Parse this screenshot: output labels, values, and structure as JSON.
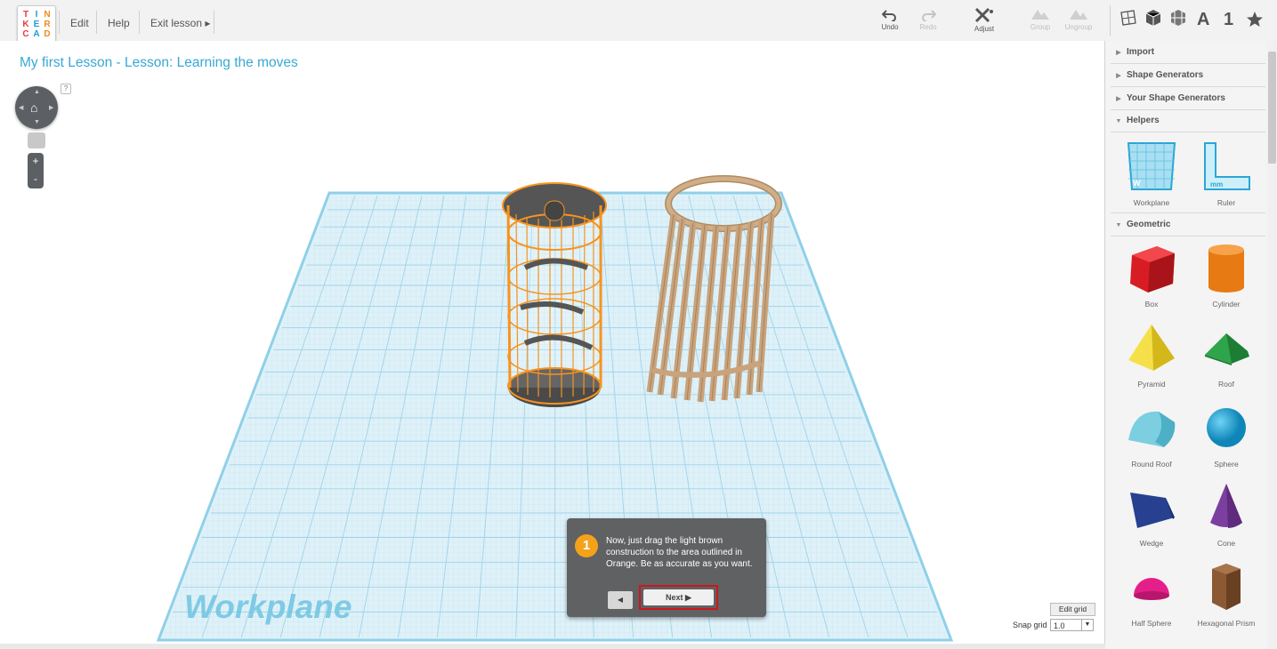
{
  "logo": {
    "letters": [
      "T",
      "I",
      "N",
      "K",
      "E",
      "R",
      "C",
      "A",
      "D"
    ]
  },
  "menu": {
    "edit": "Edit",
    "help": "Help",
    "exit_lesson": "Exit lesson ▸"
  },
  "toolbar": {
    "undo": "Undo",
    "redo": "Redo",
    "adjust": "Adjust",
    "group": "Group",
    "ungroup": "Ungroup"
  },
  "view_icons": {
    "text_icon": "A",
    "one_icon": "1"
  },
  "canvas": {
    "lesson_title": "My first Lesson - Lesson: Learning the moves",
    "help_mark": "?",
    "zoom_in": "+",
    "zoom_out": "-",
    "workplane_label": "Workplane",
    "edit_grid": "Edit grid",
    "snap_grid_label": "Snap grid",
    "snap_grid_value": "1.0"
  },
  "tip": {
    "step": "1",
    "text": "Now, just drag the light brown construction to the area outlined in Orange. Be as accurate as you want.",
    "prev": "◀",
    "next": "Next ▶"
  },
  "sidebar": {
    "sections": {
      "import": "Import",
      "shape_generators": "Shape Generators",
      "your_shape_generators": "Your Shape Generators",
      "helpers": "Helpers",
      "geometric": "Geometric"
    },
    "helpers": [
      {
        "label": "Workplane",
        "icon": "workplane-icon"
      },
      {
        "label": "Ruler",
        "icon": "ruler-icon"
      }
    ],
    "shapes": [
      {
        "label": "Box",
        "icon": "box-icon"
      },
      {
        "label": "Cylinder",
        "icon": "cylinder-icon"
      },
      {
        "label": "Pyramid",
        "icon": "pyramid-icon"
      },
      {
        "label": "Roof",
        "icon": "roof-icon"
      },
      {
        "label": "Round Roof",
        "icon": "round-roof-icon"
      },
      {
        "label": "Sphere",
        "icon": "sphere-icon"
      },
      {
        "label": "Wedge",
        "icon": "wedge-icon"
      },
      {
        "label": "Cone",
        "icon": "cone-icon"
      },
      {
        "label": "Half Sphere",
        "icon": "half-sphere-icon"
      },
      {
        "label": "Hexagonal Prism",
        "icon": "hexagonal-prism-icon"
      }
    ]
  },
  "colors": {
    "accent": "#38a8d4",
    "orange_outline": "#f7931e",
    "light_brown": "#c9a37b",
    "tip_badge": "#f3a21a",
    "next_highlight": "#d0161b"
  }
}
